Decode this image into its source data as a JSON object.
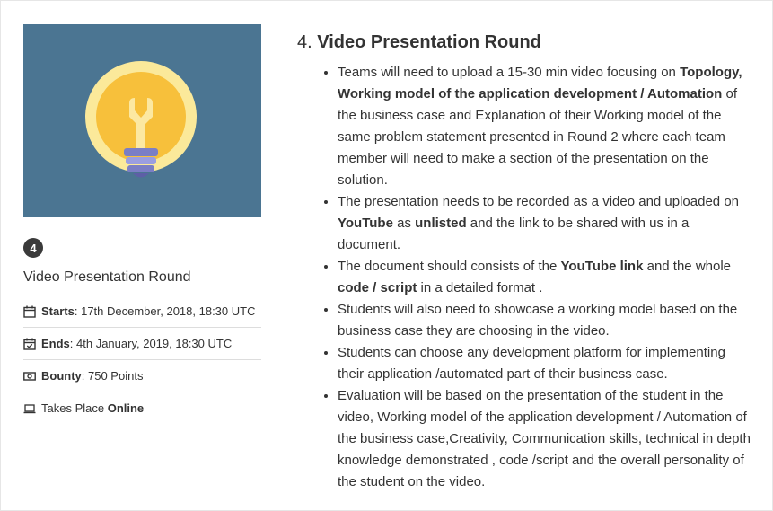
{
  "round": {
    "number": "4",
    "name": "Video Presentation Round"
  },
  "info": {
    "starts_label": "Starts",
    "starts_value": ": 17th December, 2018, 18:30 UTC",
    "ends_label": "Ends",
    "ends_value": ": 4th January, 2019, 18:30 UTC",
    "bounty_label": "Bounty",
    "bounty_value": ": 750 Points",
    "place_prefix": "Takes Place ",
    "place_value": "Online"
  },
  "content": {
    "title_number": "4.",
    "title_text": " Video Presentation Round",
    "items": [
      {
        "a": "Teams will need to upload a 15-30 min video focusing on ",
        "b": "Topology, Working model of the application development / Automation",
        "c": " of the business case and Explanation of their Working model of the same problem statement presented in Round 2 where each team member will need to make a section of the presentation on the solution."
      },
      {
        "a": "The presentation needs to be recorded as a video and uploaded on ",
        "b": "YouTube",
        "c": " as ",
        "d": "unlisted",
        "e": " and the link to be shared with us in a document."
      },
      {
        "a": "The document should consists of the ",
        "b": "YouTube link",
        "c": " and the whole ",
        "d": "code / script",
        "e": " in a detailed format ."
      },
      {
        "a": "Students will also need to showcase a working model based on the business case they are choosing in the video."
      },
      {
        "a": "Students can choose any development platform for implementing their application /automated part of their business case."
      },
      {
        "a": "Evaluation will be based on the presentation of the student in the video, Working model of the application development / Automation of the business case,Creativity, Communication skills, technical in depth knowledge demonstrated , code /script and the overall personality of the student on the video."
      }
    ]
  },
  "icons": {
    "banner": "lightbulb-icon",
    "starts": "calendar-icon",
    "ends": "calendar-check-icon",
    "bounty": "money-icon",
    "place": "laptop-icon"
  },
  "colors": {
    "banner_bg": "#4b7592",
    "badge_bg": "#3a3a3a"
  }
}
